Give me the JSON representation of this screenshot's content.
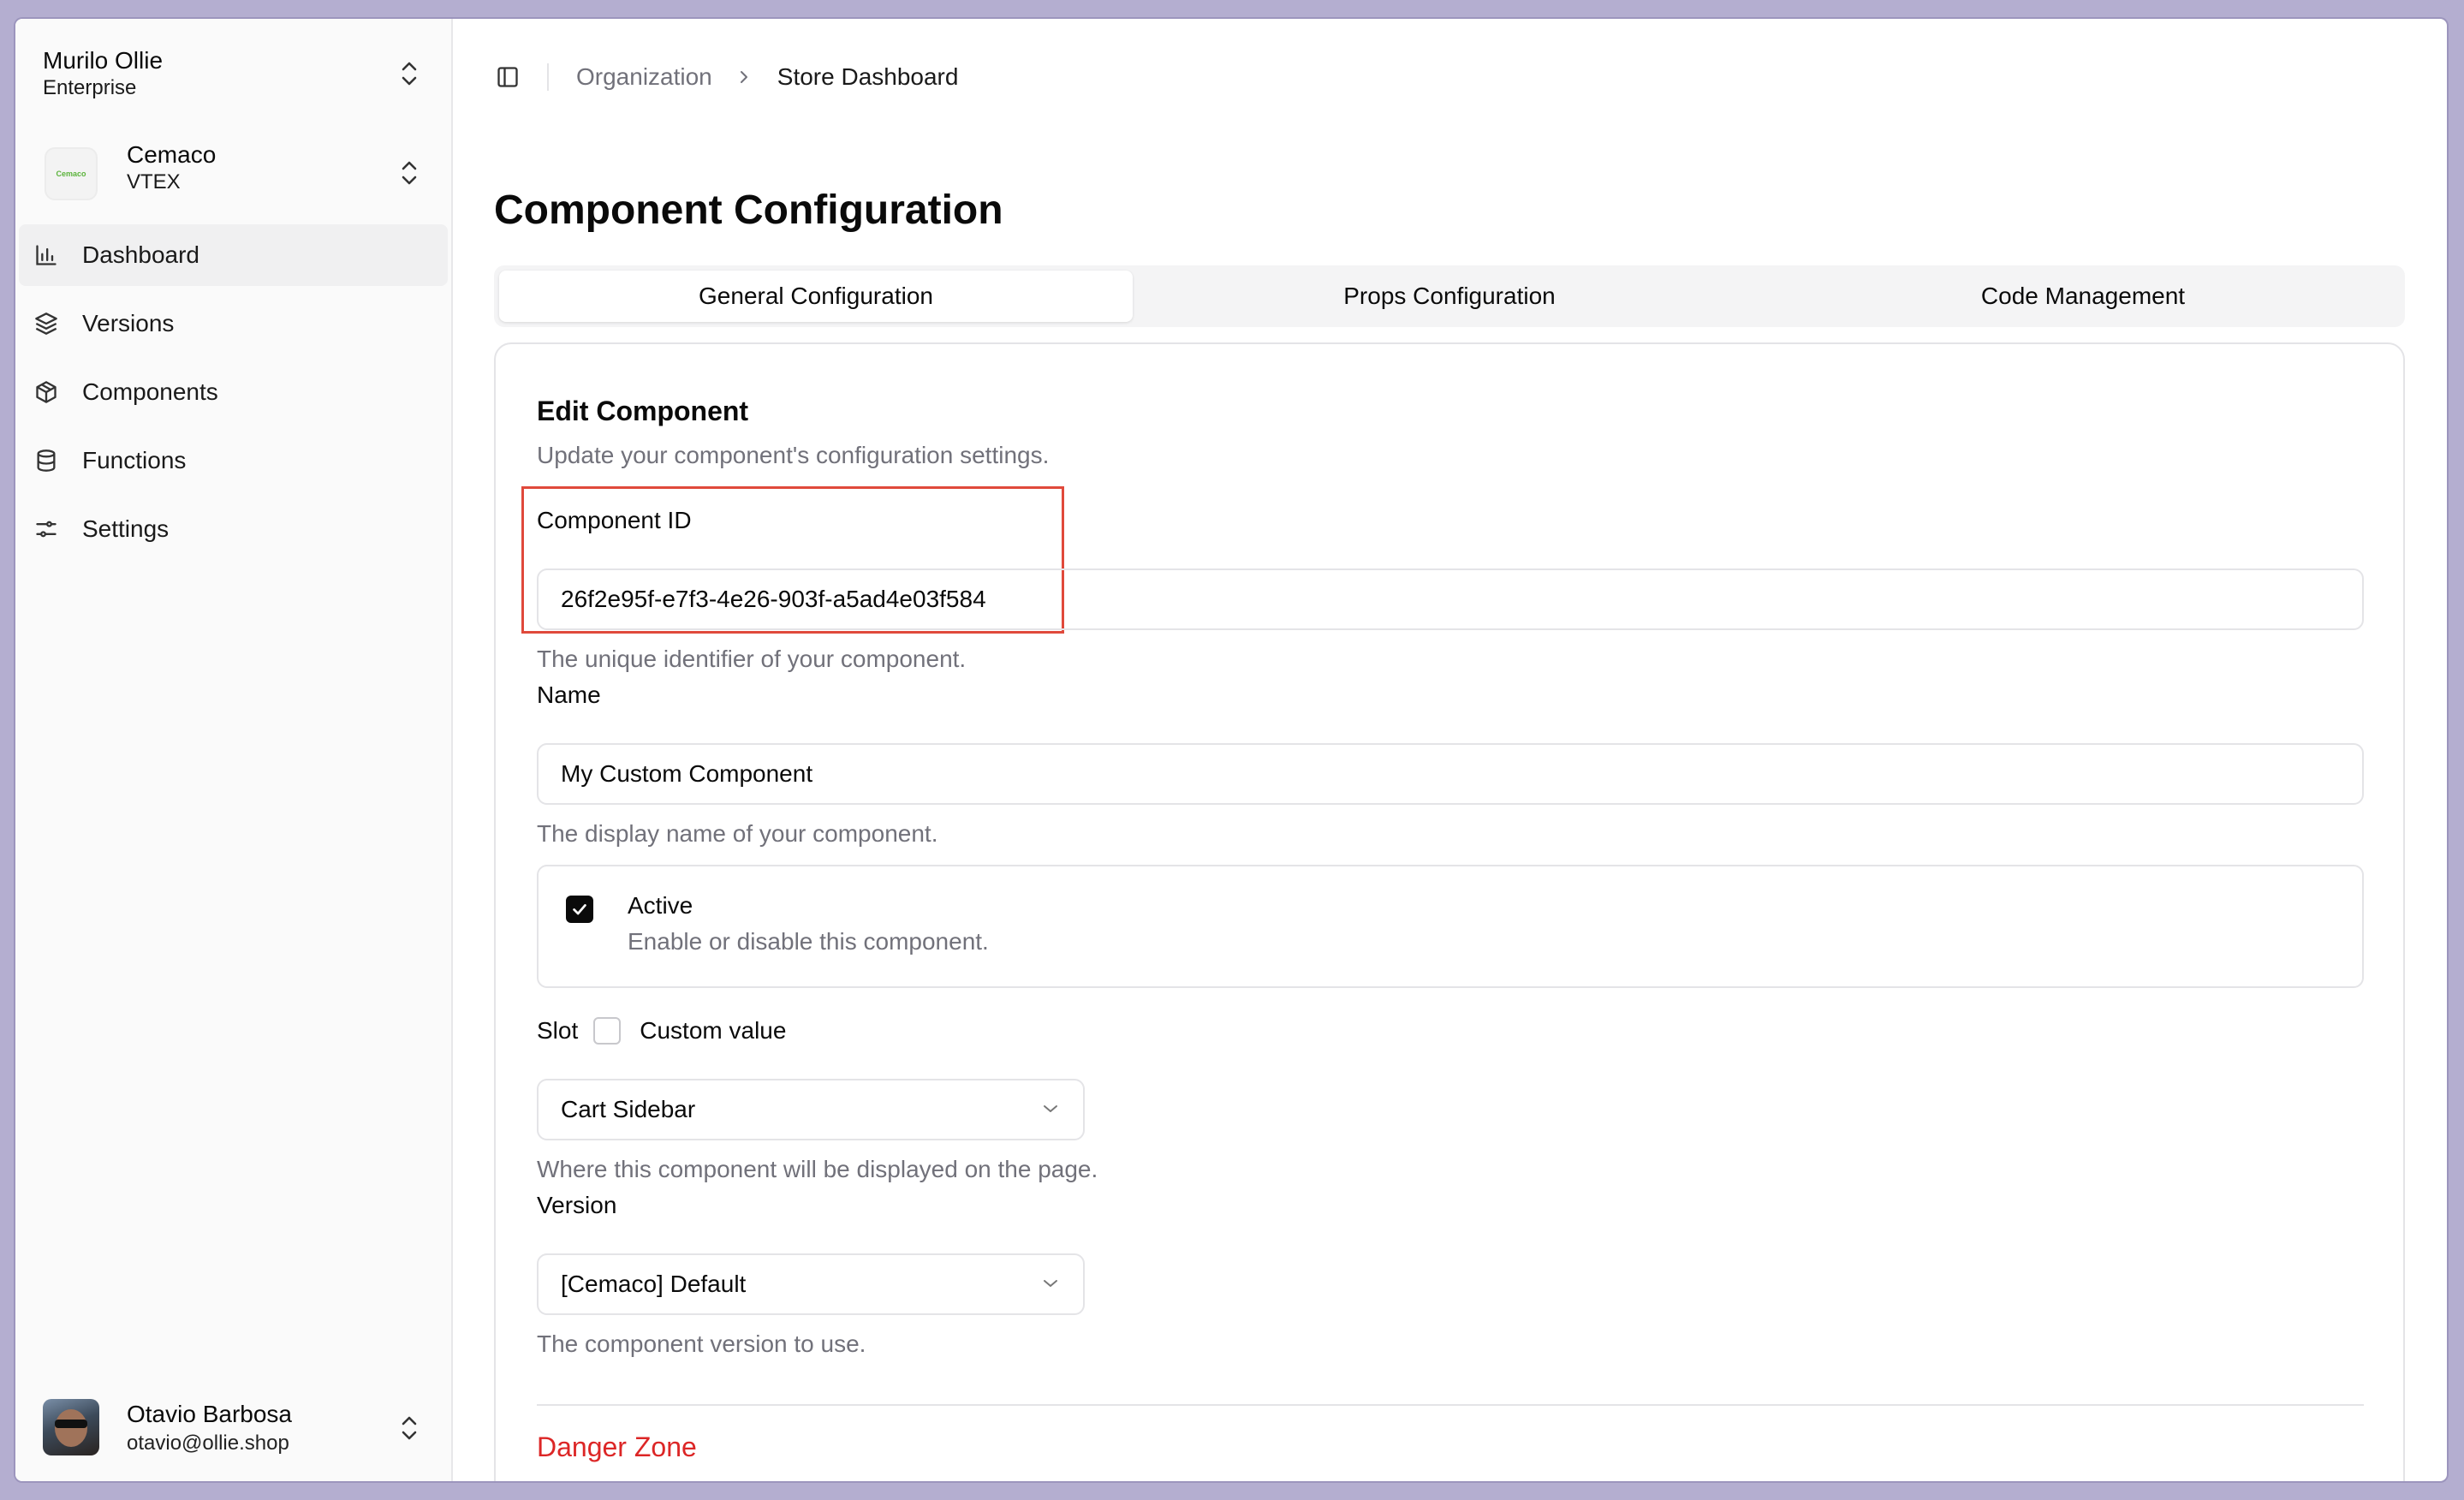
{
  "sidebar": {
    "org": {
      "name": "Murilo Ollie",
      "plan": "Enterprise"
    },
    "store": {
      "name": "Cemaco",
      "platform": "VTEX",
      "logo_text": "Cemaco"
    },
    "nav": [
      {
        "label": "Dashboard",
        "icon": "bar-chart-icon"
      },
      {
        "label": "Versions",
        "icon": "layers-icon"
      },
      {
        "label": "Components",
        "icon": "package-icon"
      },
      {
        "label": "Functions",
        "icon": "database-icon"
      },
      {
        "label": "Settings",
        "icon": "sliders-icon"
      }
    ],
    "user": {
      "name": "Otavio Barbosa",
      "email": "otavio@ollie.shop"
    }
  },
  "breadcrumb": {
    "parent": "Organization",
    "current": "Store Dashboard"
  },
  "page_title": "Component Configuration",
  "tabs": [
    {
      "label": "General Configuration",
      "active": true
    },
    {
      "label": "Props Configuration",
      "active": false
    },
    {
      "label": "Code Management",
      "active": false
    }
  ],
  "card": {
    "title": "Edit Component",
    "description": "Update your component's configuration settings.",
    "component_id": {
      "label": "Component ID",
      "value": "26f2e95f-e7f3-4e26-903f-a5ad4e03f584",
      "hint": "The unique identifier of your component."
    },
    "name": {
      "label": "Name",
      "value": "My Custom Component",
      "hint": "The display name of your component."
    },
    "active": {
      "label": "Active",
      "description": "Enable or disable this component.",
      "checked": true
    },
    "slot": {
      "label": "Slot",
      "custom_value_label": "Custom value",
      "value": "Cart Sidebar",
      "hint": "Where this component will be displayed on the page."
    },
    "version": {
      "label": "Version",
      "value": "[Cemaco] Default",
      "hint": "The component version to use."
    },
    "danger_zone": "Danger Zone"
  },
  "colors": {
    "danger": "#dc2626",
    "highlight_border": "#e0493b",
    "muted_text": "#71717a"
  }
}
